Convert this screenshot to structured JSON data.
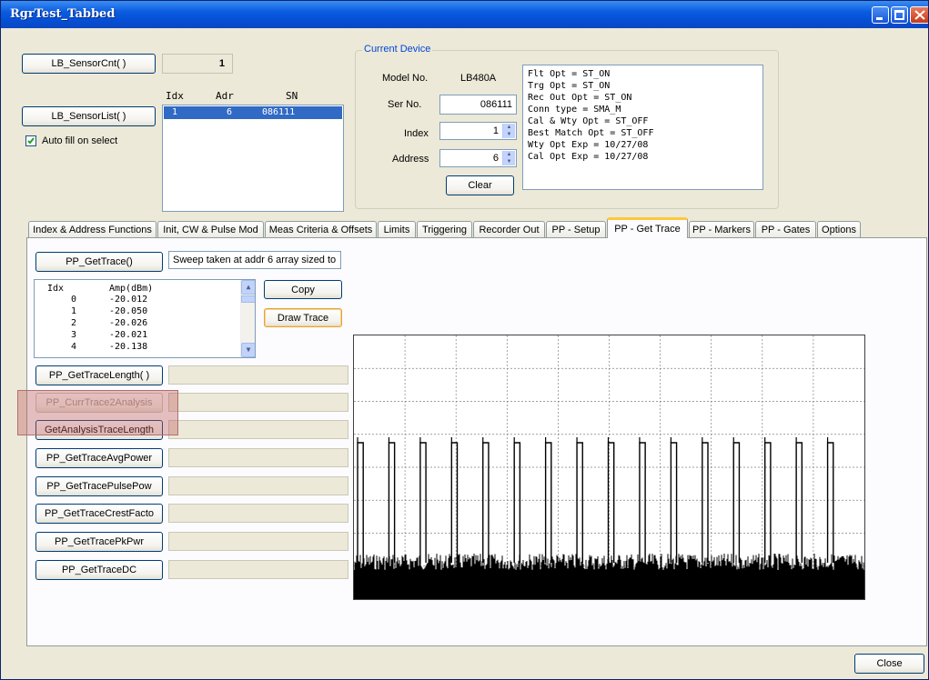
{
  "window": {
    "title": "RgrTest_Tabbed"
  },
  "sensor": {
    "cnt_button": "LB_SensorCnt( )",
    "cnt_value": "1",
    "list_button": "LB_SensorList( )",
    "autofill_label": "Auto fill on select",
    "autofill_checked": true,
    "list_headers": {
      "idx": "Idx",
      "adr": "Adr",
      "sn": "SN"
    },
    "list_rows": [
      {
        "idx": "1",
        "adr": "6",
        "sn": "086111"
      }
    ]
  },
  "device": {
    "group_title": "Current Device",
    "model_label": "Model No.",
    "model_value": "LB480A",
    "ser_label": "Ser No.",
    "ser_value": "086111",
    "index_label": "Index",
    "index_value": "1",
    "address_label": "Address",
    "address_value": "6",
    "clear_button": "Clear",
    "info_lines": [
      "Flt Opt = ST_ON",
      "Trg Opt = ST_ON",
      "Rec Out Opt = ST_ON",
      "Conn type = SMA_M",
      "Cal & Wty Opt = ST_OFF",
      "Best Match Opt = ST_OFF",
      "Wty Opt Exp = 10/27/08",
      "Cal Opt Exp = 10/27/08"
    ]
  },
  "tabs": [
    {
      "label": "Index & Address Functions"
    },
    {
      "label": "Init, CW & Pulse Mod"
    },
    {
      "label": "Meas Criteria & Offsets"
    },
    {
      "label": "Limits"
    },
    {
      "label": "Triggering"
    },
    {
      "label": "Recorder Out"
    },
    {
      "label": "PP - Setup"
    },
    {
      "label": "PP - Get Trace"
    },
    {
      "label": "PP - Markers"
    },
    {
      "label": "PP - Gates"
    },
    {
      "label": "Options"
    }
  ],
  "active_tab": "PP - Get Trace",
  "trace": {
    "get_trace_button": "PP_GetTrace()",
    "get_trace_status": "Sweep taken at addr 6 array sized to",
    "list_headers": {
      "idx": "Idx",
      "amp": "Amp(dBm)"
    },
    "list_rows": [
      {
        "idx": "0",
        "amp": "-20.012"
      },
      {
        "idx": "1",
        "amp": "-20.050"
      },
      {
        "idx": "2",
        "amp": "-20.026"
      },
      {
        "idx": "3",
        "amp": "-20.021"
      },
      {
        "idx": "4",
        "amp": "-20.138"
      }
    ],
    "copy_button": "Copy",
    "draw_trace_button": "Draw Trace",
    "functions": [
      {
        "label": "PP_GetTraceLength( )",
        "value": ""
      },
      {
        "label": "PP_CurrTrace2Analysis",
        "value": "",
        "disabled": true
      },
      {
        "label": "GetAnalysisTraceLength",
        "value": ""
      },
      {
        "label": "PP_GetTraceAvgPower",
        "value": ""
      },
      {
        "label": "PP_GetTracePulsePow",
        "value": ""
      },
      {
        "label": "PP_GetTraceCrestFacto",
        "value": ""
      },
      {
        "label": "PP_GetTracePkPwr",
        "value": ""
      },
      {
        "label": "PP_GetTraceDC",
        "value": ""
      }
    ],
    "plot": {
      "pulse_count": 16,
      "grid_columns": 10,
      "grid_rows": 8,
      "line_color": "#000000",
      "background": "#ffffff"
    }
  },
  "footer": {
    "close_button": "Close"
  },
  "colors": {
    "accent": "#316ac5",
    "tab_highlight": "#ffc83c",
    "title_bar": "#0a5ce0",
    "disabled_highlight": "#c08080"
  }
}
